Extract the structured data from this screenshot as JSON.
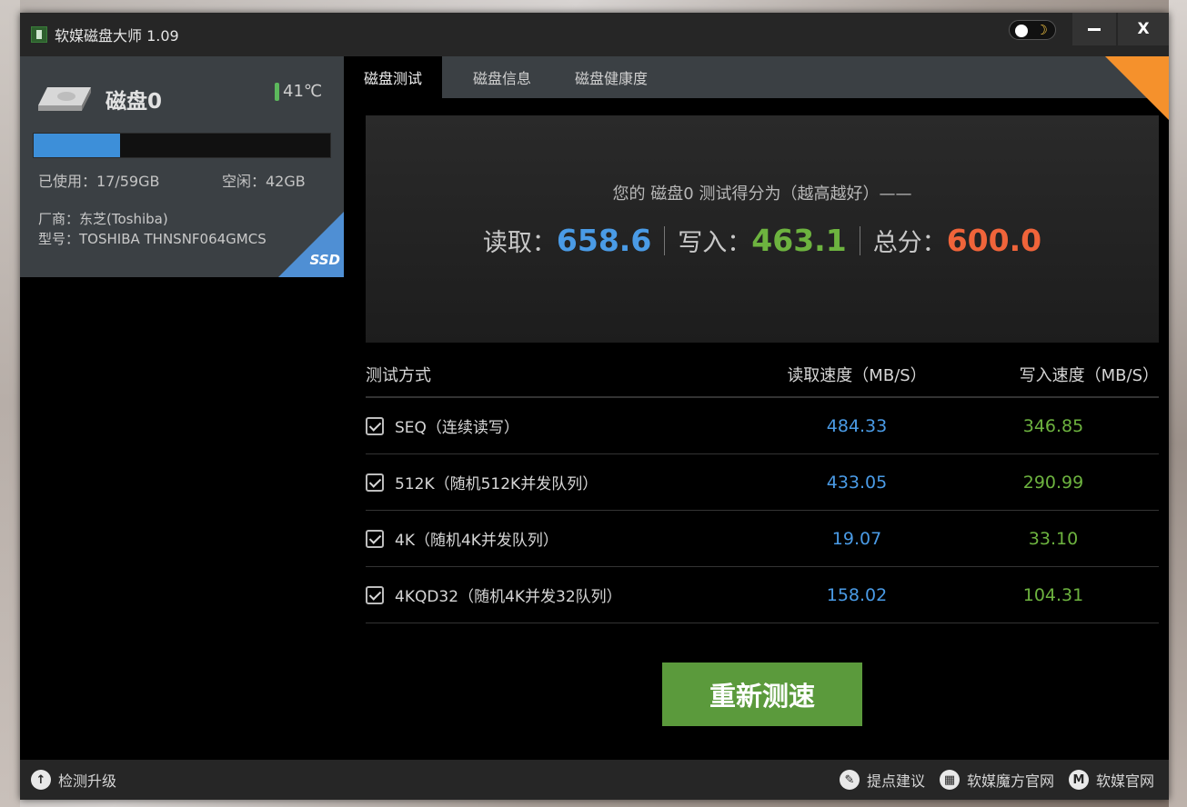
{
  "window": {
    "title": "软媒磁盘大师 1.09",
    "close_label": "X"
  },
  "disk": {
    "name": "磁盘0",
    "temperature": "41℃",
    "usage_fraction": 0.29,
    "used": "已使用：17/59GB",
    "free": "空闲：42GB",
    "vendor": "厂商：东芝(Toshiba)",
    "model": "型号：TOSHIBA THNSNF064GMCS",
    "type_badge": "SSD"
  },
  "tabs": [
    "磁盘测试",
    "磁盘信息",
    "磁盘健康度"
  ],
  "score": {
    "caption": "您的 磁盘0 测试得分为（越高越好）——",
    "read_label": "读取：",
    "read_value": "658.6",
    "write_label": "写入：",
    "write_value": "463.1",
    "total_label": "总分：",
    "total_value": "600.0"
  },
  "table": {
    "headers": [
      "测试方式",
      "读取速度（MB/S）",
      "写入速度（MB/S）"
    ],
    "rows": [
      {
        "method": "SEQ（连续读写）",
        "read": "484.33",
        "write": "346.85"
      },
      {
        "method": "512K（随机512K并发队列）",
        "read": "433.05",
        "write": "290.99"
      },
      {
        "method": "4K（随机4K并发队列）",
        "read": "19.07",
        "write": "33.10"
      },
      {
        "method": "4KQD32（随机4K并发32队列）",
        "read": "158.02",
        "write": "104.31"
      }
    ]
  },
  "retest_label": "重新测速",
  "footer": {
    "check_update": "检测升级",
    "feedback": "提点建议",
    "mofang_site": "软媒魔方官网",
    "ruanmei_site": "软媒官网",
    "ruanmei_icon_letter": "M"
  },
  "colors": {
    "read": "#4a9be6",
    "write": "#6db33f",
    "total": "#f0643a",
    "button": "#5b9a3c",
    "accent_corner": "#f5912c"
  }
}
